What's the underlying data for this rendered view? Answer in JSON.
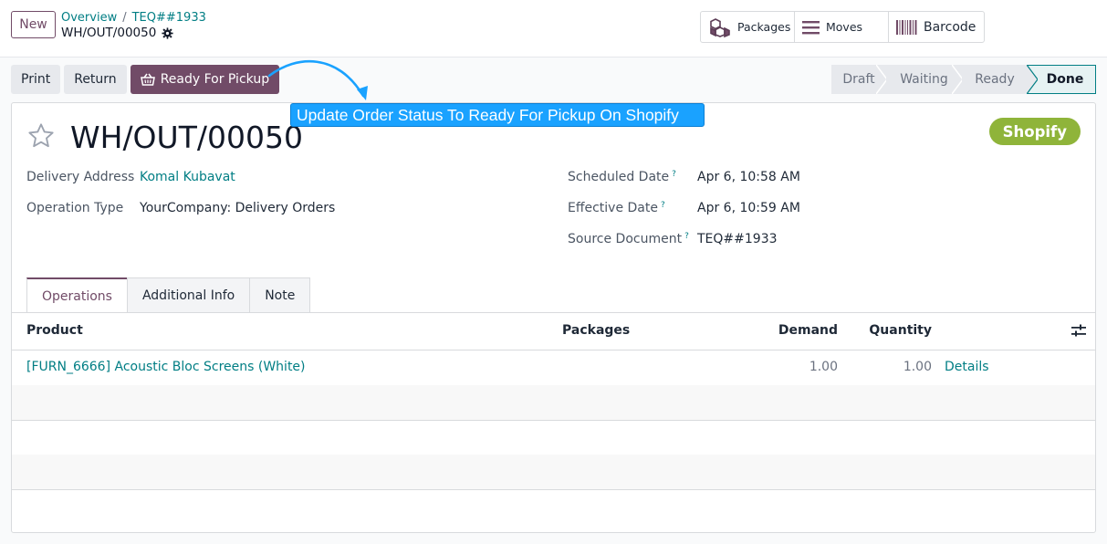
{
  "header": {
    "new_label": "New",
    "breadcrumb": [
      "Overview",
      "TEQ##1933"
    ],
    "breadcrumb_sep": "/",
    "record_title": "WH/OUT/00050"
  },
  "smart_buttons": [
    {
      "label": "Packages",
      "icon": "packages-icon"
    },
    {
      "label": "Moves",
      "icon": "list-icon"
    },
    {
      "label": "Barcode",
      "icon": "barcode-icon"
    }
  ],
  "actions": {
    "print": "Print",
    "return": "Return",
    "ready_for_pickup": "Ready For Pickup"
  },
  "status": {
    "stages": [
      "Draft",
      "Waiting",
      "Ready",
      "Done"
    ],
    "current": "Done"
  },
  "callout": {
    "text": "Update Order Status To Ready For Pickup On Shopify",
    "color": "#1aa2ff"
  },
  "form": {
    "title": "WH/OUT/00050",
    "badge": "Shopify",
    "badge_color": "#8fb43a",
    "left_fields": [
      {
        "label": "Delivery Address",
        "value": "Komal Kubavat"
      },
      {
        "label": "Operation Type",
        "value": "YourCompany: Delivery Orders"
      }
    ],
    "right_fields": [
      {
        "label": "Scheduled Date",
        "help": "?",
        "value": "Apr 6, 10:58 AM"
      },
      {
        "label": "Effective Date",
        "help": "?",
        "value": "Apr 6, 10:59 AM"
      },
      {
        "label": "Source Document",
        "help": "?",
        "value": "TEQ##1933"
      }
    ]
  },
  "tabs": [
    "Operations",
    "Additional Info",
    "Note"
  ],
  "table": {
    "columns": [
      "Product",
      "Packages",
      "Demand",
      "Quantity"
    ],
    "rows": [
      {
        "product": "[FURN_6666] Acoustic Bloc Screens (White)",
        "packages": "",
        "demand": "1.00",
        "quantity": "1.00",
        "details": "Details"
      }
    ]
  },
  "colors": {
    "accent": "#714b67",
    "link": "#017e84"
  }
}
